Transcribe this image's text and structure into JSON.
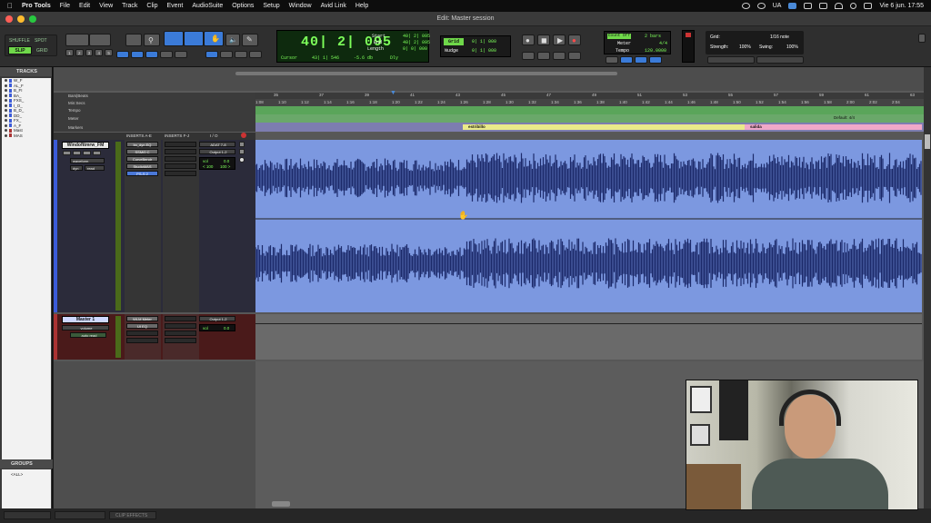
{
  "menubar": {
    "app": "Pro Tools",
    "items": [
      "File",
      "Edit",
      "View",
      "Track",
      "Clip",
      "Event",
      "AudioSuite",
      "Options",
      "Setup",
      "Window",
      "Avid Link",
      "Help"
    ],
    "status_lang": "UA",
    "clock": "Vie 6 jun.  17:55"
  },
  "window": {
    "title": "Edit: Master session"
  },
  "toolbar": {
    "mode_top": "SHUFFLE",
    "mode_top2": "SPOT",
    "mode_slip": "SLIP",
    "mode_grid": "GRID",
    "main_counter": "40| 2| 095",
    "cursor_label": "Cursor",
    "cursor_value": "43| 1| 546",
    "db_value": "-5.6 db",
    "dly_label": "Dly",
    "start_label": "Start",
    "start_value": "40| 2| 095",
    "end_label": "End",
    "end_value": "40| 2| 095",
    "length_label": "Length",
    "length_value": "0| 0| 000",
    "grid_label": "Grid",
    "grid_value": "0| 1| 000",
    "nudge_label": "Nudge",
    "nudge_value": "0| 1| 000",
    "count_off": "Count Off",
    "count_off_value": "2 bars",
    "meter_label": "Meter",
    "meter_value": "4/4",
    "tempo_label": "Tempo",
    "tempo_value": "120.0000",
    "grid2_label": "Grid:",
    "grid2_value": "1/16 note",
    "strength_label": "Strength:",
    "strength_value": "100%",
    "swing_label": "Swing:",
    "swing_value": "100%",
    "numbers": [
      "1",
      "2",
      "3",
      "4",
      "5",
      "6"
    ]
  },
  "left_panel": {
    "tracks_header": "TRACKS",
    "groups_header": "GROUPS",
    "groups_items": [
      "<ALL>"
    ],
    "track_list": [
      "W_F",
      "AL_F",
      "B_FI",
      "BA_",
      "FXS_",
      "I_O_",
      "B_D_",
      "DD_",
      "FX_",
      "A_F",
      "Mast",
      "MAS"
    ]
  },
  "rulers": {
    "bars_label": "Bars|Beats",
    "min_label": "Min:Secs",
    "tempo_label": "Tempo",
    "meter_label": "Meter",
    "markers_label": "Markers",
    "meter_default": "Default: 4/4",
    "bar_ticks": [
      "35",
      "37",
      "39",
      "41",
      "43",
      "45",
      "47",
      "49",
      "51",
      "53",
      "55",
      "57",
      "59",
      "61",
      "63"
    ],
    "min_ticks": [
      "1:08",
      "1:10",
      "1:12",
      "1:14",
      "1:16",
      "1:18",
      "1:20",
      "1:22",
      "1:24",
      "1:26",
      "1:28",
      "1:30",
      "1:32",
      "1:34",
      "1:36",
      "1:38",
      "1:40",
      "1:42",
      "1:44",
      "1:46",
      "1:48",
      "1:50",
      "1:52",
      "1:54",
      "1:56",
      "1:58",
      "2:00",
      "2:02",
      "2:04"
    ],
    "markers": [
      {
        "name": "estribillo"
      },
      {
        "name": "salida"
      }
    ]
  },
  "track_header_labels": {
    "inserts_ae": "INSERTS A-E",
    "inserts_fj": "INSERTS F-J",
    "io": "I / O"
  },
  "track1": {
    "name": "Windofttmrw_FM",
    "view": "waveform",
    "dyn": "dyn",
    "read": "read",
    "inserts": [
      "bx_dyn EQ",
      "SSM/0 C",
      "CurveBendr",
      "StudioMAS",
      "PS-S 2"
    ],
    "io_in": "ADAT 7-8",
    "io_out": "Output 1-2",
    "vol_label": "vol",
    "vol_value": "0.0",
    "pan_left": "< 100",
    "pan_right": "100 >"
  },
  "master": {
    "name": "Master 1",
    "view": "volume",
    "mode": "auto read",
    "inserts": [
      "WLM Meter",
      "UI EQ"
    ],
    "io_out": "Output 1-2",
    "vol_label": "vol",
    "vol_value": "0.0"
  },
  "bottom": {
    "tabs": [
      "",
      "",
      "CLIP EFFECTS"
    ]
  }
}
